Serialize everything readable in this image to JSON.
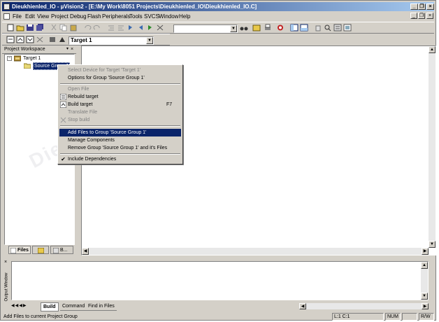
{
  "window": {
    "title": "Dieukhienled_IO - µVision2 - [E:\\My Work\\8051 Projects\\Dieukhienled_IO\\Dieukhienled_IO.C]",
    "minimize_glyph": "_",
    "restore_glyph": "❐",
    "close_glyph": "×"
  },
  "menu": {
    "items": [
      "File",
      "Edit",
      "View",
      "Project",
      "Debug",
      "Flash",
      "Peripherals",
      "Tools",
      "SVCS",
      "Window",
      "Help"
    ]
  },
  "toolbar2": {
    "target_combo": "Target 1"
  },
  "workspace": {
    "title": "Project Workspace",
    "close_glyph": "×",
    "tree": {
      "root": "Target 1",
      "child": "Source Group 1"
    },
    "tabs": [
      "Files",
      "",
      "B..."
    ]
  },
  "context_menu": {
    "items": [
      {
        "label": "Select Device for Target 'Target 1'",
        "disabled": true
      },
      {
        "label": "Options for Group 'Source Group 1'",
        "disabled": false
      },
      {
        "label": "Open File",
        "disabled": true
      },
      {
        "label": "Rebuild target",
        "disabled": false,
        "icon": "rebuild-icon"
      },
      {
        "label": "Build target",
        "disabled": false,
        "icon": "build-icon",
        "shortcut": "F7"
      },
      {
        "label": "Translate File",
        "disabled": true
      },
      {
        "label": "Stop build",
        "disabled": true,
        "icon": "stop-build-icon"
      },
      {
        "label": "Add Files to Group 'Source Group 1'",
        "disabled": false,
        "highlighted": true
      },
      {
        "label": "Manage Components",
        "disabled": false
      },
      {
        "label": "Remove Group 'Source Group 1' and it's Files",
        "disabled": false
      },
      {
        "label": "Include Dependencies",
        "disabled": false,
        "checked": true
      }
    ]
  },
  "output": {
    "side_label": "Output Window",
    "tabs": [
      "Build",
      "Command",
      "Find in Files"
    ]
  },
  "statusbar": {
    "message": "Add Files to current Project Group",
    "position": "L:1 C:1",
    "num": "NUM",
    "mode": "R/W"
  },
  "watermark": "DienTuViet.Com",
  "colors": {
    "titlebar": "#0a246a",
    "highlight": "#0a246a",
    "chrome": "#d4d0c8"
  }
}
